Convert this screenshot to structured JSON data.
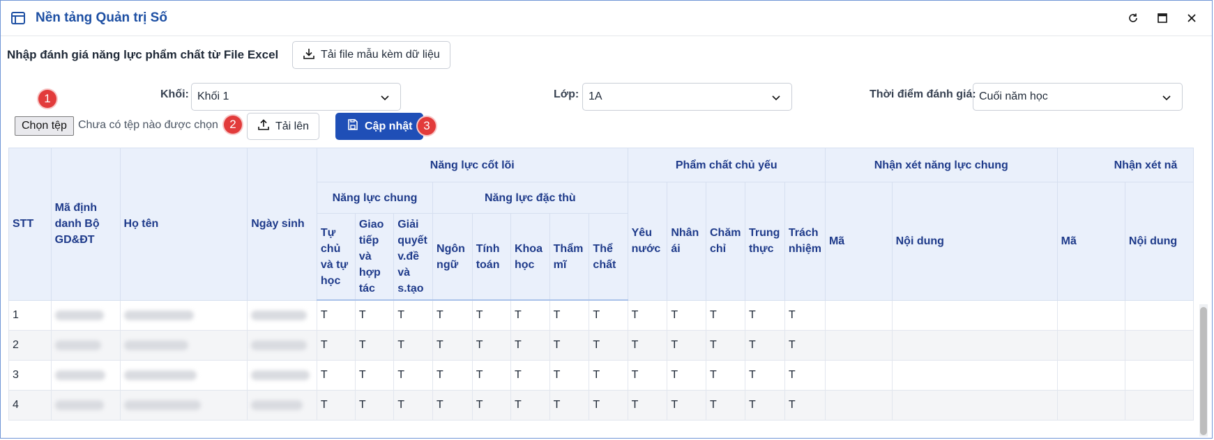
{
  "app": {
    "title": "Nền tảng Quản trị Số"
  },
  "import": {
    "title": "Nhập đánh giá năng lực phẩm chất từ File Excel",
    "template_button": "Tải file mẫu kèm dữ liệu"
  },
  "filters": {
    "grade_label": "Khối:",
    "grade_value": "Khối 1",
    "class_label": "Lớp:",
    "class_value": "1A",
    "period_label": "Thời điểm đánh giá:",
    "period_value": "Cuối năm học"
  },
  "file": {
    "choose_button": "Chọn tệp",
    "status": "Chưa có tệp nào được chọn",
    "upload_button": "Tải lên",
    "update_button": "Cập nhật"
  },
  "steps": [
    "1",
    "2",
    "3"
  ],
  "table": {
    "headers": {
      "stt": "STT",
      "student_id": "Mã định danh Bộ GD&ĐT",
      "full_name": "Họ tên",
      "dob": "Ngày sinh",
      "core_competence": "Năng lực cốt lõi",
      "general_competence": "Năng lực chung",
      "specific_competence": "Năng lực đặc thù",
      "main_qualities": "Phẩm chất chủ yếu",
      "general_comment": "Nhận xét năng lực chung",
      "second_comment": "Nhận xét nă",
      "self_study": "Tự chủ và tự học",
      "communication": "Giao tiếp và hợp tác",
      "problem_solving": "Giải quyết v.đề và s.tạo",
      "language": "Ngôn ngữ",
      "math": "Tính toán",
      "science": "Khoa học",
      "aesthetics": "Thẩm mĩ",
      "physical": "Thể chất",
      "patriotism": "Yêu nước",
      "kindness": "Nhân ái",
      "diligence": "Chăm chỉ",
      "honesty": "Trung thực",
      "responsibility": "Trách nhiệm",
      "code": "Mã",
      "content": "Nội dung",
      "code_2": "Mã",
      "content_2": "Nội dung"
    },
    "rows": [
      {
        "stt": "1",
        "grades": [
          "T",
          "T",
          "T",
          "T",
          "T",
          "T",
          "T",
          "T",
          "T",
          "T",
          "T",
          "T",
          "T"
        ]
      },
      {
        "stt": "2",
        "grades": [
          "T",
          "T",
          "T",
          "T",
          "T",
          "T",
          "T",
          "T",
          "T",
          "T",
          "T",
          "T",
          "T"
        ]
      },
      {
        "stt": "3",
        "grades": [
          "T",
          "T",
          "T",
          "T",
          "T",
          "T",
          "T",
          "T",
          "T",
          "T",
          "T",
          "T",
          "T"
        ]
      },
      {
        "stt": "4",
        "grades": [
          "T",
          "T",
          "T",
          "T",
          "T",
          "T",
          "T",
          "T",
          "T",
          "T",
          "T",
          "T",
          "T"
        ]
      }
    ]
  }
}
